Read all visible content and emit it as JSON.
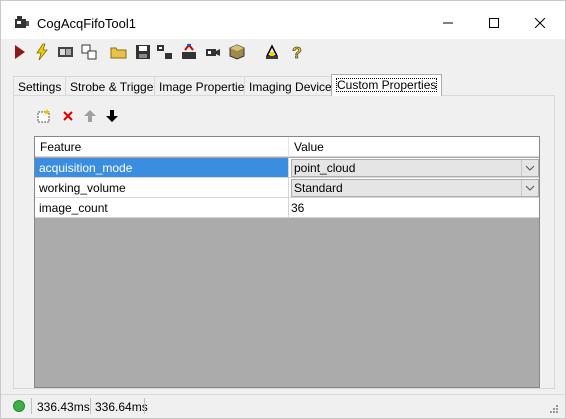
{
  "window": {
    "title": "CogAcqFifoTool1",
    "minimize_glyph": "—",
    "maximize_glyph": "☐",
    "close_glyph": "✕"
  },
  "toolbar": {
    "icons": [
      "run-icon",
      "lightning-icon",
      "image-display-icon",
      "copy-icon",
      "open-folder-icon",
      "save-icon",
      "grab-icon",
      "reset-icon",
      "camera-icon",
      "cube-icon",
      "measure-icon",
      "help-icon"
    ]
  },
  "tabs": [
    {
      "label": "Settings",
      "active": false
    },
    {
      "label": "Strobe & Trigger",
      "active": false
    },
    {
      "label": "Image Properties",
      "active": false
    },
    {
      "label": "Imaging Device",
      "active": false
    },
    {
      "label": "Custom Properties",
      "active": true
    }
  ],
  "prop_toolbar": {
    "icons": [
      "new-item-icon",
      "delete-icon",
      "move-up-icon",
      "move-down-icon"
    ]
  },
  "grid": {
    "columns": [
      "Feature",
      "Value"
    ],
    "rows": [
      {
        "feature": "acquisition_mode",
        "value": "point_cloud",
        "type": "combo",
        "selected": true
      },
      {
        "feature": "working_volume",
        "value": "Standard",
        "type": "combo",
        "selected": false
      },
      {
        "feature": "image_count",
        "value": "36",
        "type": "text",
        "selected": false
      }
    ]
  },
  "status": {
    "time1": "336.43ms",
    "time2": "336.64ms",
    "led_color": "#3cb043"
  },
  "colors": {
    "selection": "#3b8de0",
    "grid_background": "#ababab"
  }
}
